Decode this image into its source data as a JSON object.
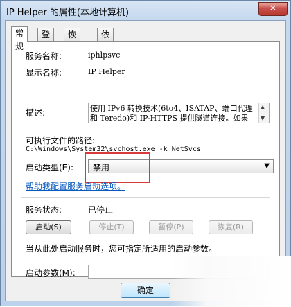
{
  "window": {
    "title": "IP Helper 的属性(本地计算机)",
    "close_glyph": "✕"
  },
  "tabs": [
    "常规",
    "登录",
    "恢复",
    "依存关系"
  ],
  "general": {
    "service_name_label": "服务名称:",
    "service_name_value": "iphlpsvc",
    "display_name_label": "显示名称:",
    "display_name_value": "IP Helper",
    "description_label": "描述:",
    "description_value": "使用 IPv6 转换技术(6to4、ISATAP、端口代理和 Teredo)和 IP-HTTPS 提供隧道连接。如果",
    "exe_path_label": "可执行文件的路径:",
    "exe_path_value": "C:\\Windows\\System32\\svchost.exe -k NetSvcs",
    "startup_type_label": "启动类型(E):",
    "startup_type_value": "禁用",
    "help_link": "帮助我配置服务启动选项。",
    "status_label": "服务状态:",
    "status_value": "已停止",
    "buttons": {
      "start": "启动(S)",
      "stop": "停止(T)",
      "pause": "暂停(P)",
      "resume": "恢复(R)"
    },
    "hint": "当从此处启动服务时，您可指定所适用的启动参数。",
    "params_label": "启动参数(M):",
    "params_value": ""
  },
  "footer": {
    "ok": "确定"
  }
}
